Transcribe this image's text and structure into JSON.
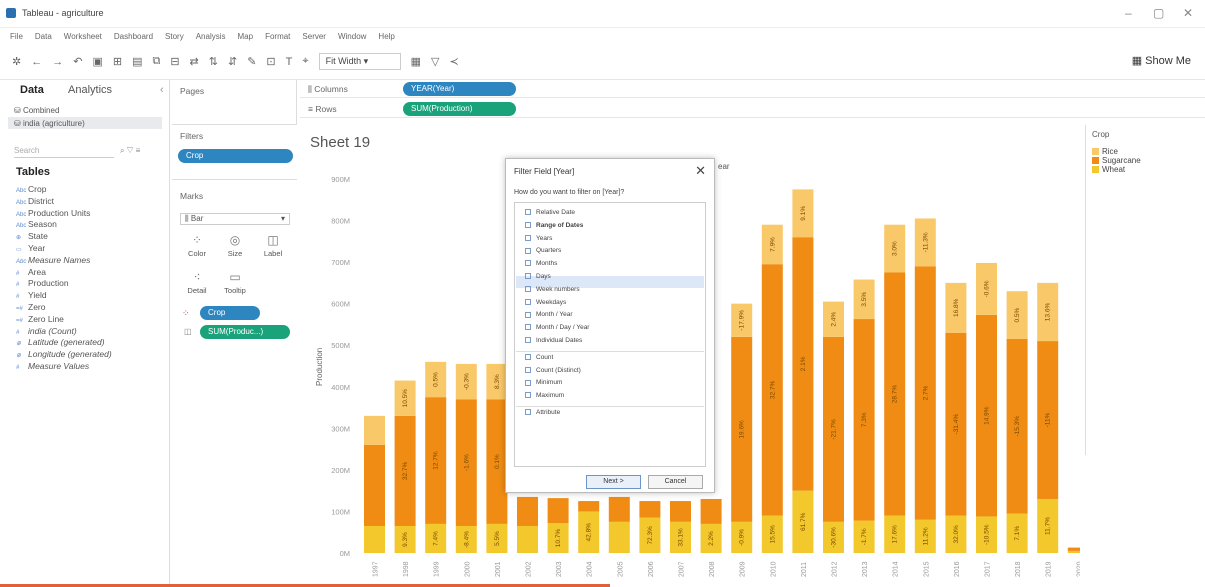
{
  "window": {
    "title": "Tableau - agriculture",
    "controls": [
      "–",
      "▢",
      "✕"
    ]
  },
  "menu": [
    "File",
    "Data",
    "Worksheet",
    "Dashboard",
    "Story",
    "Analysis",
    "Map",
    "Format",
    "Server",
    "Window",
    "Help"
  ],
  "toolbar": {
    "fit": "Fit Width",
    "show_me": "Show Me"
  },
  "data_pane": {
    "tab_data": "Data",
    "tab_analytics": "Analytics",
    "sources": [
      "Combined",
      "india (agriculture)"
    ],
    "search_placeholder": "Search",
    "tables_header": "Tables",
    "fields": [
      {
        "label": "Crop",
        "icon": "Abc",
        "italic": false
      },
      {
        "label": "District",
        "icon": "Abc",
        "italic": false
      },
      {
        "label": "Production Units",
        "icon": "Abc",
        "italic": false
      },
      {
        "label": "Season",
        "icon": "Abc",
        "italic": false
      },
      {
        "label": "State",
        "icon": "⊕",
        "italic": false
      },
      {
        "label": "Year",
        "icon": "▭",
        "italic": false
      },
      {
        "label": "Measure Names",
        "icon": "Abc",
        "italic": true
      },
      {
        "label": "Area",
        "icon": "#",
        "italic": false
      },
      {
        "label": "Production",
        "icon": "#",
        "italic": false
      },
      {
        "label": "Yield",
        "icon": "#",
        "italic": false
      },
      {
        "label": "Zero",
        "icon": "=#",
        "italic": false
      },
      {
        "label": "Zero Line",
        "icon": "=#",
        "italic": false
      },
      {
        "label": "india (Count)",
        "icon": "#",
        "italic": true
      },
      {
        "label": "Latitude (generated)",
        "icon": "⊕",
        "italic": true
      },
      {
        "label": "Longitude (generated)",
        "icon": "⊕",
        "italic": true
      },
      {
        "label": "Measure Values",
        "icon": "#",
        "italic": true
      }
    ]
  },
  "pages": {
    "label": "Pages"
  },
  "filters": {
    "label": "Filters",
    "pill": "Crop"
  },
  "marks": {
    "label": "Marks",
    "type": "Bar",
    "buttons": [
      "Color",
      "Size",
      "Label",
      "Detail",
      "Tooltip"
    ],
    "pills": [
      "Crop",
      "SUM(Produc...)"
    ]
  },
  "shelves": {
    "columns_label": "Columns",
    "columns_pill": "YEAR(Year)",
    "rows_label": "Rows",
    "rows_pill": "SUM(Production)"
  },
  "sheet": {
    "title": "Sheet 19",
    "legend_title": "Crop",
    "year_header": "ear"
  },
  "legend": [
    {
      "name": "Rice",
      "color": "#f9c869"
    },
    {
      "name": "Sugarcane",
      "color": "#f08c13"
    },
    {
      "name": "Wheat",
      "color": "#f2c82c"
    }
  ],
  "dialog": {
    "title": "Filter Field [Year]",
    "question": "How do you want to filter on [Year]?",
    "options_a": [
      {
        "label": "Relative Date",
        "bold": false
      },
      {
        "label": "Range of Dates",
        "bold": true
      },
      {
        "label": "Years",
        "bold": false
      },
      {
        "label": "Quarters",
        "bold": false
      },
      {
        "label": "Months",
        "bold": false
      },
      {
        "label": "Days",
        "bold": false
      },
      {
        "label": "Week numbers",
        "bold": false
      },
      {
        "label": "Weekdays",
        "bold": false
      },
      {
        "label": "Month / Year",
        "bold": false
      },
      {
        "label": "Month / Day / Year",
        "bold": false
      },
      {
        "label": "Individual Dates",
        "bold": false
      }
    ],
    "options_b": [
      "Count",
      "Count (Distinct)",
      "Minimum",
      "Maximum"
    ],
    "options_c": [
      "Attribute"
    ],
    "next": "Next >",
    "cancel": "Cancel"
  },
  "chart_data": {
    "type": "bar",
    "stacked": true,
    "ylabel": "Production",
    "ylim": [
      0,
      900
    ],
    "yunit": "M",
    "yticks": [
      "0M",
      "100M",
      "200M",
      "300M",
      "400M",
      "500M",
      "600M",
      "700M",
      "800M",
      "900M"
    ],
    "categories": [
      "1997",
      "1998",
      "1999",
      "2000",
      "2001",
      "2002",
      "2003",
      "2004",
      "2005",
      "2006",
      "2007",
      "2008",
      "2009",
      "2010",
      "2011",
      "2012",
      "2013",
      "2014",
      "2015",
      "2016",
      "2017",
      "2018",
      "2019",
      "2020"
    ],
    "series": [
      {
        "name": "Wheat",
        "color": "#f2c82c",
        "values": [
          65,
          65,
          70,
          65,
          70,
          65,
          72,
          100,
          75,
          85,
          75,
          70,
          75,
          90,
          150,
          75,
          78,
          90,
          80,
          90,
          88,
          95,
          130,
          5
        ],
        "labels": [
          "",
          "9.3%",
          "7.4%",
          "-8.4%",
          "5.5%",
          "",
          "10.7%",
          "42.8%",
          "",
          "72.3%",
          "33.1%",
          "2.2%",
          "-0.9%",
          "15.5%",
          "61.7%",
          "-30.6%",
          "-1.7%",
          "17.6%",
          "11.2%",
          "32.0%",
          "-10.5%",
          "7.1%",
          "11.7%",
          ""
        ]
      },
      {
        "name": "Sugarcane",
        "color": "#f08c13",
        "values": [
          195,
          265,
          305,
          305,
          300,
          70,
          60,
          25,
          60,
          40,
          50,
          60,
          445,
          605,
          610,
          445,
          485,
          585,
          610,
          440,
          485,
          420,
          380,
          8
        ],
        "labels": [
          "",
          "32.7%",
          "12.7%",
          "-1.6%",
          "0.1%",
          "",
          "",
          "",
          "",
          "",
          "",
          "",
          "19.6%",
          "32.7%",
          "2.1%",
          "-21.7%",
          "7.3%",
          "28.7%",
          "2.7%",
          "-31.4%",
          "14.9%",
          "-15.3%",
          "-11%",
          ""
        ]
      },
      {
        "name": "Rice",
        "color": "#f9c869",
        "values": [
          70,
          85,
          85,
          85,
          85,
          0,
          0,
          0,
          0,
          0,
          0,
          0,
          80,
          95,
          115,
          85,
          95,
          115,
          115,
          120,
          125,
          115,
          140,
          0
        ],
        "labels": [
          "",
          "10.5%",
          "0.5%",
          "-0.3%",
          "8.3%",
          "",
          "",
          "",
          "",
          "",
          "",
          "",
          "-17.9%",
          "7.9%",
          "9.1%",
          "2.4%",
          "3.5%",
          "3.0%",
          "-11.3%",
          "16.8%",
          "-0.6%",
          "0.5%",
          "13.6%",
          ""
        ]
      }
    ]
  }
}
